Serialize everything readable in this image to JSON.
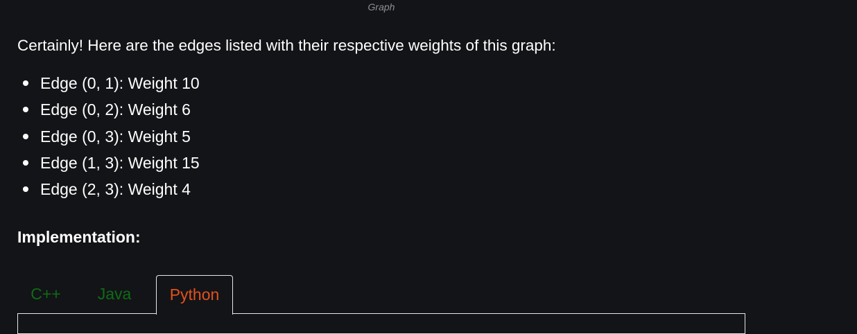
{
  "caption": "Graph",
  "intro": "Certainly! Here are the edges listed with their respective weights of this graph:",
  "edges": [
    "Edge (0, 1): Weight 10",
    "Edge (0, 2): Weight 6",
    "Edge (0, 3): Weight 5",
    "Edge (1, 3): Weight 15",
    "Edge (2, 3): Weight 4"
  ],
  "implementation_heading": "Implementation:",
  "tabs": [
    {
      "label": "C++",
      "active": false
    },
    {
      "label": "Java",
      "active": false
    },
    {
      "label": "Python",
      "active": true
    }
  ],
  "colors": {
    "background": "#131417",
    "inactive_tab": "#0f6b17",
    "active_tab": "#e2511c"
  }
}
